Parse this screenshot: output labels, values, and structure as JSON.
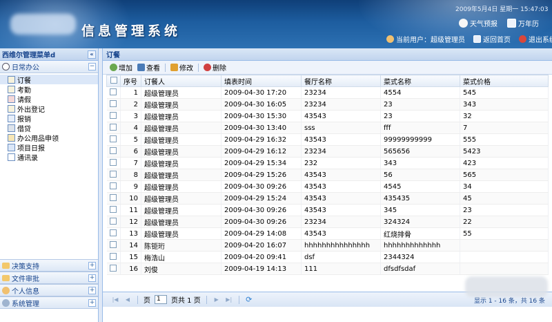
{
  "app": {
    "title": "信息管理系统",
    "datetime": "2009年5月4日 星期一 15:47:03",
    "weather_label": "天气预报",
    "calendar_label": "万年历",
    "current_user": "当前用户：超级管理员",
    "home_label": "返回首页",
    "logout_label": "退出系统"
  },
  "sidebar": {
    "header": "西维尔管理菜单d",
    "collapse_symbol": "«",
    "groups": [
      {
        "label": "日常办公",
        "toggle": "−"
      },
      {
        "label": "决策支持",
        "toggle": "+"
      },
      {
        "label": "文件审批",
        "toggle": "+"
      },
      {
        "label": "个人信息",
        "toggle": "+"
      },
      {
        "label": "系统管理",
        "toggle": "+"
      }
    ],
    "items": [
      {
        "label": "订餐"
      },
      {
        "label": "考勤"
      },
      {
        "label": "请假"
      },
      {
        "label": "外出登记"
      },
      {
        "label": "报销"
      },
      {
        "label": "借贷"
      },
      {
        "label": "办公用品申领"
      },
      {
        "label": "项目日报"
      },
      {
        "label": "通讯录"
      }
    ]
  },
  "main": {
    "panel_title": "订餐",
    "collapse_symbol": "»",
    "actions": [
      {
        "label": "增加",
        "icon": "add-icon",
        "color": "#6aa84f"
      },
      {
        "label": "查看",
        "icon": "view-icon",
        "color": "#4a7bb7"
      },
      {
        "label": "修改",
        "icon": "edit-icon",
        "color": "#e0a030"
      },
      {
        "label": "删除",
        "icon": "delete-icon",
        "color": "#d04040"
      }
    ],
    "columns": [
      "序号",
      "订餐人",
      "填表时间",
      "餐厅名称",
      "菜式名称",
      "菜式价格"
    ],
    "rows": [
      {
        "no": "1",
        "person": "超级管理员",
        "time": "2009-04-30 17:20",
        "restaurant": "23234",
        "dish": "4554",
        "price": "545"
      },
      {
        "no": "2",
        "person": "超级管理员",
        "time": "2009-04-30 16:05",
        "restaurant": "23234",
        "dish": "23",
        "price": "343"
      },
      {
        "no": "3",
        "person": "超级管理员",
        "time": "2009-04-30 15:30",
        "restaurant": "43543",
        "dish": "23",
        "price": "32"
      },
      {
        "no": "4",
        "person": "超级管理员",
        "time": "2009-04-30 13:40",
        "restaurant": "sss",
        "dish": "fff",
        "price": "7"
      },
      {
        "no": "5",
        "person": "超级管理员",
        "time": "2009-04-29 16:32",
        "restaurant": "43543",
        "dish": "99999999999",
        "price": "555"
      },
      {
        "no": "6",
        "person": "超级管理员",
        "time": "2009-04-29 16:12",
        "restaurant": "23234",
        "dish": "565656",
        "price": "5423"
      },
      {
        "no": "7",
        "person": "超级管理员",
        "time": "2009-04-29 15:34",
        "restaurant": "232",
        "dish": "343",
        "price": "423"
      },
      {
        "no": "8",
        "person": "超级管理员",
        "time": "2009-04-29 15:26",
        "restaurant": "43543",
        "dish": "56",
        "price": "565"
      },
      {
        "no": "9",
        "person": "超级管理员",
        "time": "2009-04-30 09:26",
        "restaurant": "43543",
        "dish": "4545",
        "price": "34"
      },
      {
        "no": "10",
        "person": "超级管理员",
        "time": "2009-04-29 15:24",
        "restaurant": "43543",
        "dish": "435435",
        "price": "45"
      },
      {
        "no": "11",
        "person": "超级管理员",
        "time": "2009-04-30 09:26",
        "restaurant": "43543",
        "dish": "345",
        "price": "23"
      },
      {
        "no": "12",
        "person": "超级管理员",
        "time": "2009-04-30 09:26",
        "restaurant": "23234",
        "dish": "324324",
        "price": "22"
      },
      {
        "no": "13",
        "person": "超级管理员",
        "time": "2009-04-29 14:08",
        "restaurant": "43543",
        "dish": "红烧排骨",
        "price": "55"
      },
      {
        "no": "14",
        "person": "陈钜珩",
        "time": "2009-04-20 16:07",
        "restaurant": "hhhhhhhhhhhhhhh",
        "dish": "hhhhhhhhhhhhh",
        "price": ""
      },
      {
        "no": "15",
        "person": "梅浩山",
        "time": "2009-04-20 09:41",
        "restaurant": "dsf",
        "dish": "2344324",
        "price": ""
      },
      {
        "no": "16",
        "person": "刘俊",
        "time": "2009-04-19 14:13",
        "restaurant": "111",
        "dish": "dfsdfsdaf",
        "price": ""
      }
    ]
  },
  "pager": {
    "page_label": "页",
    "page_value": "1",
    "total_label": "页共 1 页",
    "summary": "显示 1 - 16 条，共 16 条"
  }
}
